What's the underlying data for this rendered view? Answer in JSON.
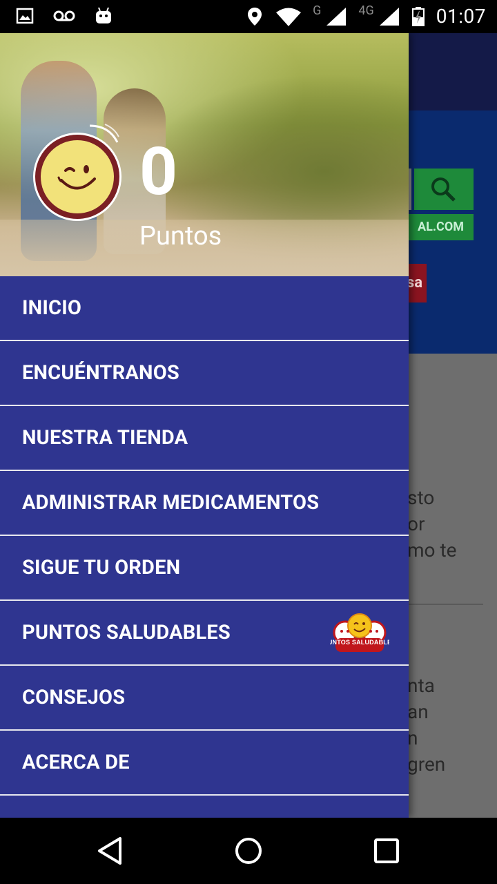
{
  "status_bar": {
    "time": "01:07",
    "network": "G",
    "network2": "4G",
    "icons": [
      "image-icon",
      "voicemail-icon",
      "android-icon",
      "location-icon",
      "wifi-icon",
      "signal-icon",
      "signal-4g-icon",
      "battery-charging-icon"
    ]
  },
  "background_app": {
    "domain_fragment": "AL.COM",
    "banner_fragment": "sa",
    "text_block_1": [
      "sto",
      "or",
      "mo te"
    ],
    "text_block_2": [
      "nta",
      "an",
      "n",
      "gren"
    ]
  },
  "drawer": {
    "points": {
      "value": "0",
      "label": "Puntos"
    },
    "menu": [
      {
        "label": "INICIO"
      },
      {
        "label": "ENCUÉNTRANOS"
      },
      {
        "label": "NUESTRA TIENDA"
      },
      {
        "label": "ADMINISTRAR MEDICAMENTOS"
      },
      {
        "label": "SIGUE TU ORDEN"
      },
      {
        "label": "PUNTOS SALUDABLES",
        "badge_text": "PUNTOS SALUDABLES"
      },
      {
        "label": "CONSEJOS"
      },
      {
        "label": "ACERCA DE"
      },
      {
        "label": ""
      }
    ]
  },
  "colors": {
    "drawer_bg": "#2f3590",
    "divider": "#e8e8ee",
    "accent_green": "#1e8a3a",
    "avatar_ring": "#7b2024",
    "avatar_face": "#f2e27a"
  }
}
